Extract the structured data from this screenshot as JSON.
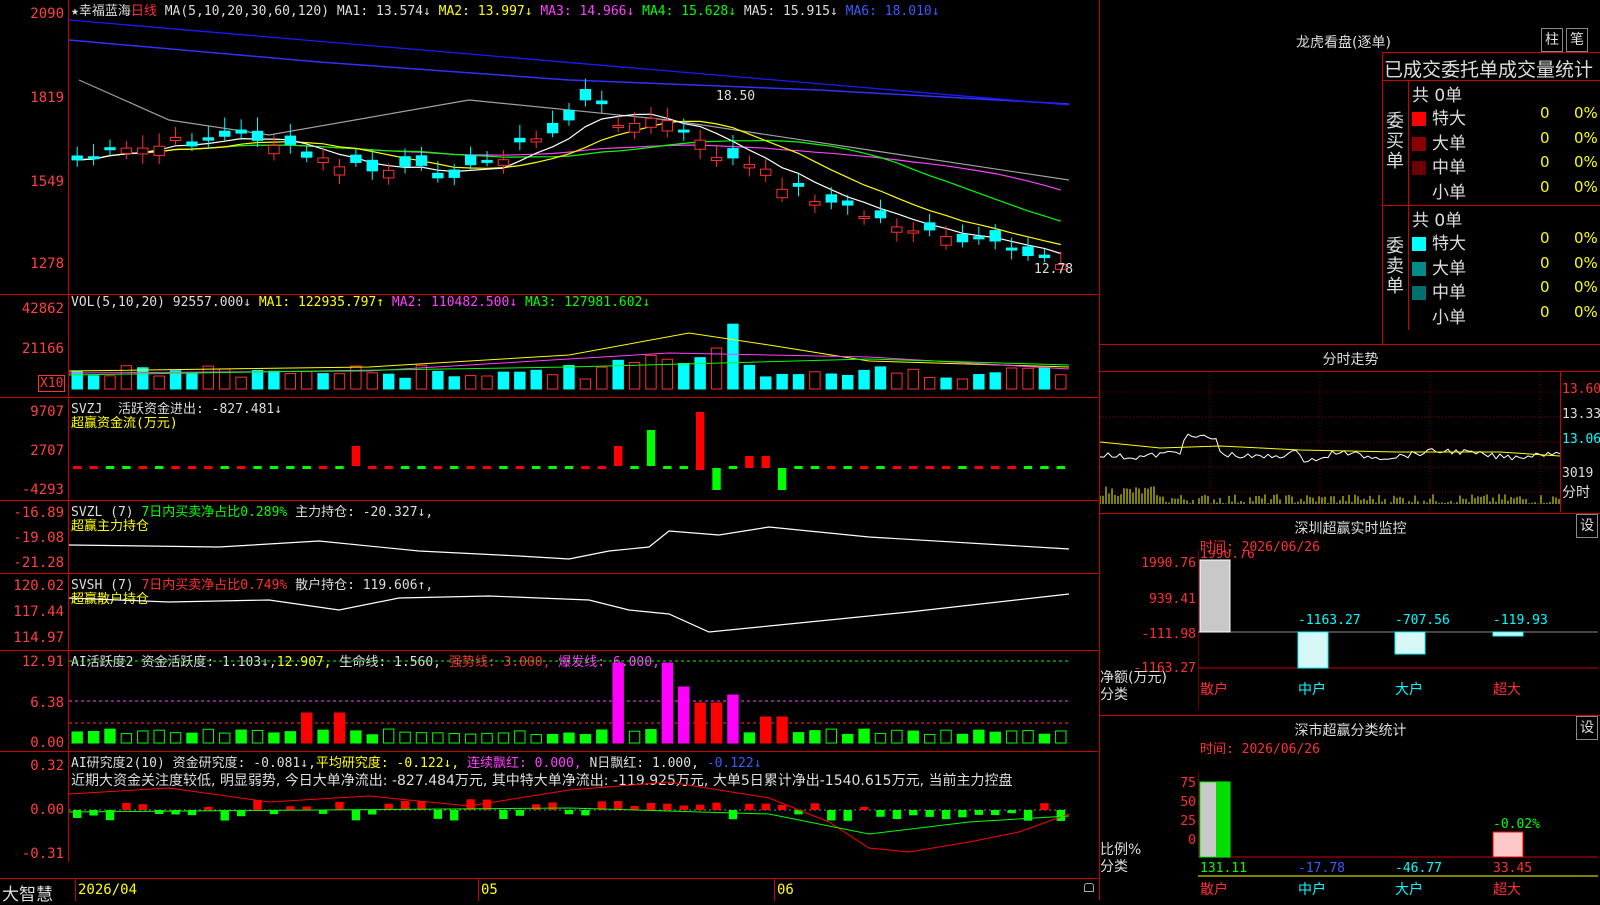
{
  "main_header": {
    "star": "★",
    "name": "幸福蓝海",
    "period": "日线",
    "label": "MA(5,10,20,30,60,120)",
    "ma1": "MA1: 13.574↓",
    "ma2": "MA2: 13.997↓",
    "ma3": "MA3: 14.966↓",
    "ma4": "MA4: 15.628↓",
    "ma5": "MA5: 15.915↓",
    "ma6": "MA6: 18.010↓"
  },
  "main_y": [
    "2090",
    "1819",
    "1549",
    "1278"
  ],
  "price_high": "18.50",
  "price_low": "12.78",
  "vol_header": {
    "label": "VOL(5,10,20)",
    "val": "92557.000↓",
    "ma1": "MA1: 122935.797↑",
    "ma2": "MA2: 110482.500↓",
    "ma3": "MA3: 127981.602↓"
  },
  "vol_y": [
    "42862",
    "21166"
  ],
  "vol_mult": "X10",
  "svzj": {
    "label": "SVZJ",
    "text": "活跃资金进出: -827.481↓",
    "sub": "超赢资金流(万元)",
    "y": [
      "9707",
      "2707",
      "-4293"
    ]
  },
  "svzl": {
    "label": "SVZL (7)",
    "t1": "7日内买卖净占比0.289%",
    "t2": "主力持仓: -20.327↓,",
    "sub": "超赢主力持仓",
    "y": [
      "-16.89",
      "-19.08",
      "-21.28"
    ]
  },
  "svsh": {
    "label": "SVSH (7)",
    "t1": "7日内买卖净占比0.749%",
    "t2": "散户持仓: 119.606↑,",
    "sub": "超赢散户持仓",
    "y": [
      "120.02",
      "117.44",
      "114.97"
    ]
  },
  "ai1": {
    "label": "AI活跃度2",
    "t1": "资金活跃度: 1.103↓,",
    "t2": "12.907,",
    "t3": "生命线: 1.560,",
    "t4": "强势线: 3.000,",
    "t5": "爆发线: 6.000,",
    "y": [
      "12.91",
      "6.38",
      "0.00"
    ]
  },
  "ai2": {
    "label": "AI研究度2(10)",
    "t1": "资金研究度: -0.081↓,",
    "t2": "平均研究度: -0.122↓,",
    "t3": "连续飘红: 0.000,",
    "t4": "N日飘红: 1.000,",
    "t5": "-0.122↓",
    "note": "近期大资金关注度较低, 明显弱势, 今日大单净流出: -827.484万元, 其中特大单净流出: -119.925万元, 大单5日累计净出-1540.615万元, 当前主力控盘",
    "y": [
      "0.32",
      "0.00",
      "-0.31"
    ]
  },
  "footer": {
    "brand": "大智慧",
    "d1": "2026/04",
    "d2": "05",
    "d3": "06"
  },
  "lhb": {
    "title": "龙虎看盘(逐单)",
    "btn1": "柱",
    "btn2": "笔",
    "heading": "已成交委托单成交量统计",
    "buy_total": "共 0单",
    "sell_total": "共 0单",
    "buy_side": "委买单",
    "sell_side": "委卖单",
    "buy_rows": [
      {
        "label": "特大",
        "v": "0",
        "p": "0%",
        "c": "#ff0000"
      },
      {
        "label": "大单",
        "v": "0",
        "p": "0%",
        "c": "#8b0000"
      },
      {
        "label": "中单",
        "v": "0",
        "p": "0%",
        "c": "#6a0000"
      },
      {
        "label": "小单",
        "v": "0",
        "p": "0%",
        "c": ""
      }
    ],
    "sell_rows": [
      {
        "label": "特大",
        "v": "0",
        "p": "0%",
        "c": "#00ffff"
      },
      {
        "label": "大单",
        "v": "0",
        "p": "0%",
        "c": "#008b8b"
      },
      {
        "label": "中单",
        "v": "0",
        "p": "0%",
        "c": "#006f6f"
      },
      {
        "label": "小单",
        "v": "0",
        "p": "0%",
        "c": ""
      }
    ]
  },
  "fenshi": {
    "title": "分时走势",
    "y": [
      "13.60",
      "13.33",
      "13.06"
    ],
    "vol": "3019",
    "vol_lab": "分时"
  },
  "monitor": {
    "title": "深圳超赢实时监控",
    "btn": "设",
    "time": "时间: 2026/06/26",
    "y": [
      "1990.76",
      "939.41",
      "-111.98",
      "-1163.27"
    ],
    "ylabel1": "净额(万元)",
    "ylabel2": "分类",
    "top": "1990.76",
    "labels": [
      "散户",
      "中户",
      "大户",
      "超大"
    ],
    "vals": [
      "-1163.27",
      "-707.56",
      "-119.93"
    ]
  },
  "classify": {
    "title": "深市超赢分类统计",
    "btn": "设",
    "time": "时间: 2026/06/26",
    "y": [
      "75",
      "50",
      "25",
      "0"
    ],
    "ylabel1": "比例%",
    "ylabel2": "分类",
    "labels": [
      "散户",
      "中户",
      "大户",
      "超大"
    ],
    "bottom_vals": [
      "131.11",
      "-17.78",
      "-46.77",
      "33.45"
    ],
    "top_val": "-0.02%"
  }
}
